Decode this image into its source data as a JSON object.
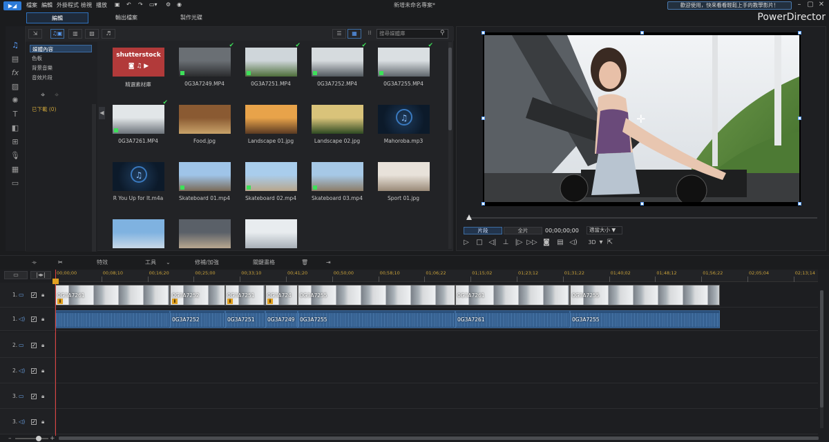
{
  "titlebar": {
    "menus": [
      "檔案",
      "編輯",
      "外掛程式",
      "檢視",
      "播放"
    ],
    "project": "新增未命名專案*",
    "notice": "歡迎使用，快來看看輕鬆上手的教學影片！",
    "controls": [
      "–",
      "▢",
      "✕"
    ]
  },
  "modes": {
    "edit": "編輯",
    "output": "輸出檔案",
    "disc": "製作光碟"
  },
  "brand": "PowerDirector",
  "library": {
    "search_placeholder": "搜尋媒體庫",
    "tree": [
      {
        "label": "媒體內容",
        "selected": true
      },
      {
        "label": "色板"
      },
      {
        "label": "背景音樂"
      },
      {
        "label": "音效片段"
      }
    ],
    "downloaded": "已下載  (0)",
    "items": [
      {
        "label": "精選素材庫",
        "kind": "stock",
        "stock_text": "shutterstock"
      },
      {
        "label": "0G3A7249.MP4",
        "kind": "video",
        "checked": true,
        "colors": [
          "#6a6f74",
          "#2b2c2e"
        ]
      },
      {
        "label": "0G3A7251.MP4",
        "kind": "video",
        "checked": true,
        "colors": [
          "#cfd6da",
          "#4e6e3a"
        ]
      },
      {
        "label": "0G3A7252.MP4",
        "kind": "video",
        "checked": true,
        "colors": [
          "#d6dbde",
          "#535a60"
        ]
      },
      {
        "label": "0G3A7255.MP4",
        "kind": "video",
        "checked": true,
        "colors": [
          "#dadfe2",
          "#5f666c"
        ]
      },
      {
        "label": "0G3A7261.MP4",
        "kind": "video",
        "checked": true,
        "colors": [
          "#e2e6e8",
          "#6c737a"
        ]
      },
      {
        "label": "Food.jpg",
        "kind": "image",
        "colors": [
          "#8a5a32",
          "#c9a36a"
        ]
      },
      {
        "label": "Landscape 01.jpg",
        "kind": "image",
        "colors": [
          "#e8a34a",
          "#5a3a22"
        ]
      },
      {
        "label": "Landscape 02.jpg",
        "kind": "image",
        "colors": [
          "#d9c37a",
          "#2e4a22"
        ]
      },
      {
        "label": "Mahoroba.mp3",
        "kind": "audio"
      },
      {
        "label": "R You Up for It.m4a",
        "kind": "audio"
      },
      {
        "label": "Skateboard 01.mp4",
        "kind": "video",
        "colors": [
          "#9fc4e8",
          "#7a6a58"
        ]
      },
      {
        "label": "Skateboard 02.mp4",
        "kind": "video",
        "colors": [
          "#a9cdec",
          "#b8a68c"
        ]
      },
      {
        "label": "Skateboard 03.mp4",
        "kind": "video",
        "colors": [
          "#a6c8e6",
          "#8c7c68"
        ]
      },
      {
        "label": "Sport 01.jpg",
        "kind": "image",
        "colors": [
          "#e8e2da",
          "#9a8a78"
        ]
      },
      {
        "label": "",
        "kind": "image",
        "colors": [
          "#7fb2e0",
          "#c8d8e8"
        ]
      },
      {
        "label": "",
        "kind": "image",
        "colors": [
          "#5a6068",
          "#b8a890"
        ]
      },
      {
        "label": "",
        "kind": "image",
        "colors": [
          "#e8ecef",
          "#a8b0b8"
        ]
      }
    ]
  },
  "preview": {
    "clip_label": "片段",
    "movie_label": "全片",
    "timecode": "00;00;00;00",
    "fit_label": "適當大小 ▼",
    "threed": "3D"
  },
  "edit_toolbar": {
    "effects": "特效",
    "tools": "工具",
    "fix": "修補/加強",
    "keyframe": "關鍵畫格"
  },
  "timeline": {
    "ticks": [
      "00;00;00",
      "00;08;10",
      "00;16;20",
      "00;25;00",
      "00;33;10",
      "00;41;20",
      "00;50;00",
      "00;58;10",
      "01;06;22",
      "01;15;02",
      "01;23;12",
      "01;31;22",
      "01;40;02",
      "01;48;12",
      "01;56;22",
      "02;05;04",
      "02;13;14"
    ],
    "tracks": [
      "1.",
      "1.",
      "2.",
      "2.",
      "3.",
      "3."
    ],
    "clips": [
      {
        "name": "0G3A7261",
        "video_label": "0G3A7261"
      },
      {
        "name": "0G3A7252",
        "video_label": "0G3A7252"
      },
      {
        "name": "0G3A7251",
        "video_label": "0G3A7251"
      },
      {
        "name": "0G3A7249",
        "video_label": "0G3A724"
      },
      {
        "name": "0G3A7255",
        "video_label": "0G3A7255"
      },
      {
        "name": "0G3A7261",
        "video_label": "0G3A7261"
      },
      {
        "name": "0G3A7255",
        "video_label": "0G3A7255"
      }
    ]
  },
  "colors": {
    "accent": "#2f73c0",
    "playhead": "#e04040",
    "ruler_text": "#c9a23a",
    "audio_clip": "#2a4f7a"
  }
}
